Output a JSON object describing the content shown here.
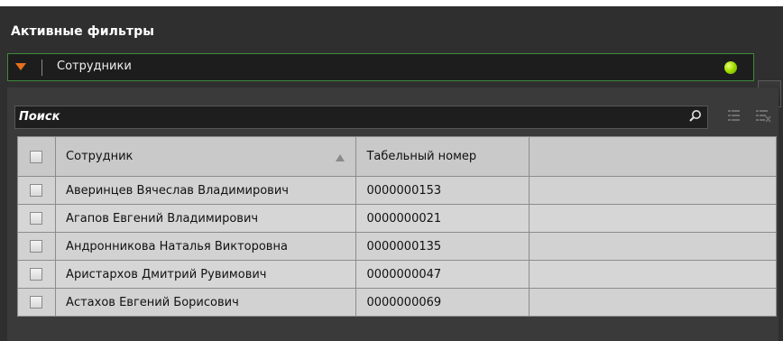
{
  "panel": {
    "title": "Активные фильтры"
  },
  "group": {
    "label": "Сотрудники",
    "status_color": "#a6e000",
    "expand_icon": "triangle-down-icon",
    "download_icon": "download-icon"
  },
  "search": {
    "placeholder": "Поиск",
    "icon": "search-icon"
  },
  "toolbar": {
    "icons": [
      "list-select-icon",
      "list-clear-icon"
    ]
  },
  "table": {
    "columns": [
      "Сотрудник",
      "Табельный номер",
      ""
    ],
    "sort_column": "Сотрудник",
    "sort_direction": "asc",
    "rows": [
      {
        "name": "Аверинцев Вячеслав Владимирович",
        "number": "0000000153",
        "checked": false
      },
      {
        "name": "Агапов Евгений Владимирович",
        "number": "0000000021",
        "checked": false
      },
      {
        "name": "Андронникова Наталья Викторовна",
        "number": "0000000135",
        "checked": false
      },
      {
        "name": "Аристархов Дмитрий Рувимович",
        "number": "0000000047",
        "checked": false
      },
      {
        "name": "Астахов Евгений Борисович",
        "number": "0000000069",
        "checked": false
      }
    ]
  },
  "colors": {
    "panel_bg": "#2f2f2f",
    "accent_orange": "#e8701c",
    "group_border": "#3f8a3c"
  }
}
